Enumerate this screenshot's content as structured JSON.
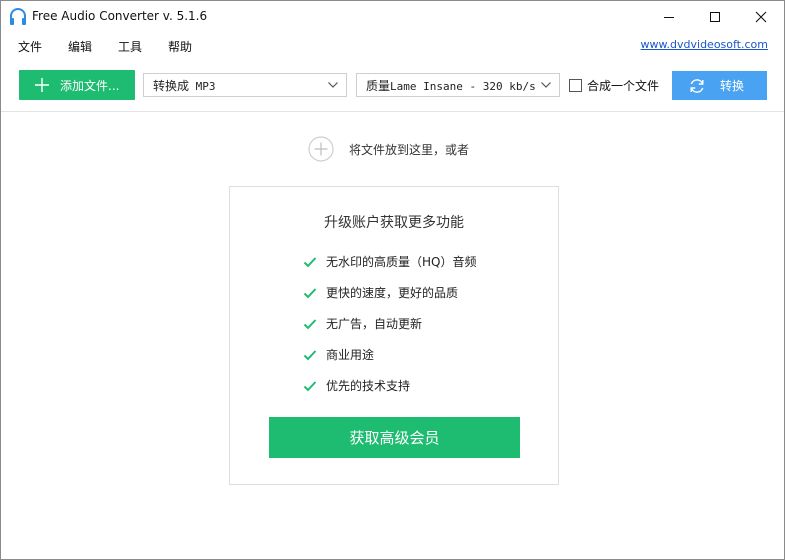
{
  "window": {
    "title": "Free Audio Converter v. 5.1.6"
  },
  "menu": {
    "items": [
      "文件",
      "编辑",
      "工具",
      "帮助"
    ],
    "site_link": "www.dvdvideosoft.com"
  },
  "toolbar": {
    "add_label": "添加文件...",
    "format_prefix": "转换成",
    "format_value": "MP3",
    "quality_prefix": "质量",
    "quality_value": "Lame Insane - 320 kb/s",
    "merge_label": "合成一个文件",
    "merge_checked": false,
    "convert_label": "转换"
  },
  "drop": {
    "text": "将文件放到这里，或者"
  },
  "upgrade": {
    "title": "升级账户获取更多功能",
    "features": [
      "无水印的高质量（HQ）音频",
      "更快的速度，更好的品质",
      "无广告，自动更新",
      "商业用途",
      "优先的技术支持"
    ],
    "button_label": "获取高级会员"
  },
  "colors": {
    "green": "#1ebc71",
    "blue": "#4aa3f2",
    "link": "#1a56c8"
  },
  "icons": {
    "app": "headphones-icon",
    "add": "plus-icon",
    "convert": "refresh-icon",
    "check": "check-icon"
  }
}
